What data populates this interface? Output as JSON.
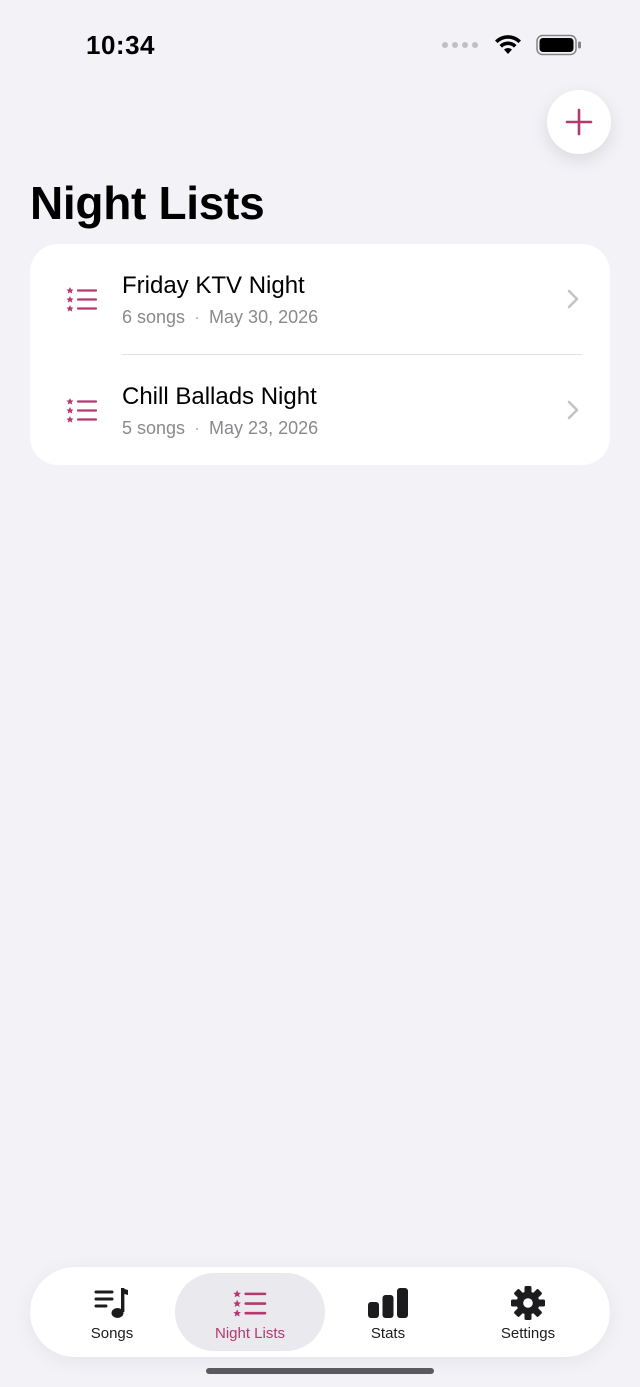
{
  "status_bar": {
    "time": "10:34"
  },
  "colors": {
    "accent": "#b5386f",
    "background": "#f2f2f7",
    "card": "#ffffff",
    "secondary_text": "#8a8a8e"
  },
  "header": {
    "add_icon": "plus-icon",
    "title": "Night Lists"
  },
  "night_lists": [
    {
      "icon": "star-list-icon",
      "title": "Friday KTV Night",
      "songs": "6 songs",
      "separator": "·",
      "date": "May 30, 2026"
    },
    {
      "icon": "star-list-icon",
      "title": "Chill Ballads Night",
      "songs": "5 songs",
      "separator": "·",
      "date": "May 23, 2026"
    }
  ],
  "tab_bar": {
    "tabs": [
      {
        "label": "Songs",
        "icon": "music-list-icon",
        "active": false
      },
      {
        "label": "Night Lists",
        "icon": "star-list-icon",
        "active": true
      },
      {
        "label": "Stats",
        "icon": "bar-chart-icon",
        "active": false
      },
      {
        "label": "Settings",
        "icon": "gear-icon",
        "active": false
      }
    ]
  }
}
